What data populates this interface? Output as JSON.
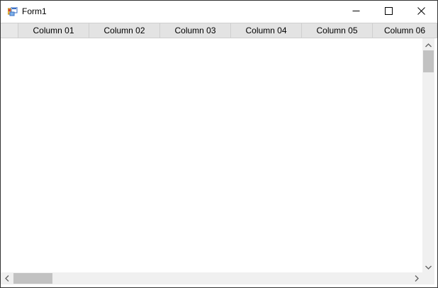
{
  "window": {
    "title": "Form1"
  },
  "grid": {
    "columns": [
      {
        "header": "Column 01"
      },
      {
        "header": "Column 02"
      },
      {
        "header": "Column 03"
      },
      {
        "header": "Column 04"
      },
      {
        "header": "Column 05"
      },
      {
        "header": "Column 06"
      }
    ]
  },
  "icons": {
    "app": "form-app-icon",
    "minimize": "minimize-icon",
    "maximize": "maximize-icon",
    "close": "close-icon",
    "scroll_up": "chevron-up-icon",
    "scroll_down": "chevron-down-icon",
    "scroll_left": "chevron-left-icon",
    "scroll_right": "chevron-right-icon"
  },
  "colors": {
    "header_background": "#e3e3e3",
    "scrollbar_track": "#f0f0f0",
    "scrollbar_thumb": "#c2c2c2",
    "window_border": "#333333"
  }
}
